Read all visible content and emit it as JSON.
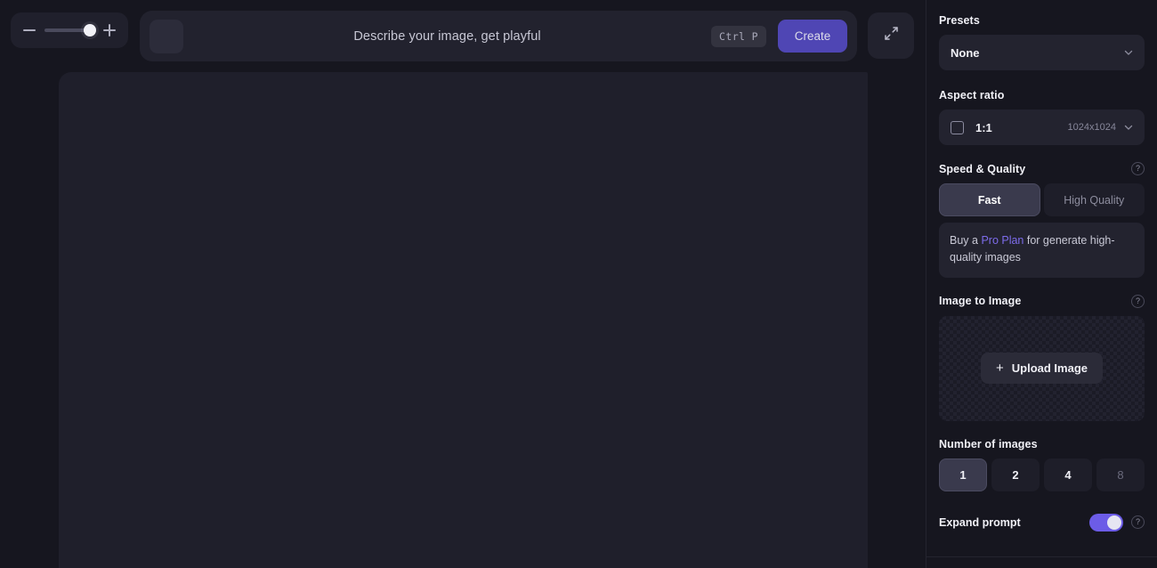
{
  "toolbar": {
    "zoom": {
      "minus_label": "−",
      "plus_label": "+",
      "value_percent": "78"
    },
    "prompt": {
      "placeholder": "Describe your image, get playful",
      "value": "",
      "shortcut": "Ctrl P",
      "create_label": "Create"
    },
    "expand_canvas_tooltip": "Expand"
  },
  "sidebar": {
    "presets": {
      "title": "Presets",
      "selected": "None"
    },
    "aspect_ratio": {
      "title": "Aspect ratio",
      "selected": "1:1",
      "dimensions": "1024x1024"
    },
    "speed_quality": {
      "title": "Speed & Quality",
      "help": "?",
      "options": [
        {
          "label": "Fast",
          "active": true
        },
        {
          "label": "High Quality",
          "active": false
        }
      ],
      "notice_prefix": "Buy a ",
      "notice_link": "Pro Plan",
      "notice_suffix": " for generate high-quality images"
    },
    "image_to_image": {
      "title": "Image to Image",
      "help": "?",
      "upload_label": "Upload Image",
      "upload_plus": "+"
    },
    "number_of_images": {
      "title": "Number of images",
      "options": [
        {
          "label": "1",
          "active": true,
          "disabled": false
        },
        {
          "label": "2",
          "active": false,
          "disabled": false
        },
        {
          "label": "4",
          "active": false,
          "disabled": false
        },
        {
          "label": "8",
          "active": false,
          "disabled": true
        }
      ]
    },
    "expand_prompt": {
      "title": "Expand prompt",
      "enabled": true,
      "help": "?"
    }
  },
  "colors": {
    "accent": "#6c5ce7",
    "create_button": "#4f46b4",
    "link": "#7d6ceb",
    "background": "#16161f",
    "panel": "#23232f",
    "canvas": "#1f1f2b"
  }
}
